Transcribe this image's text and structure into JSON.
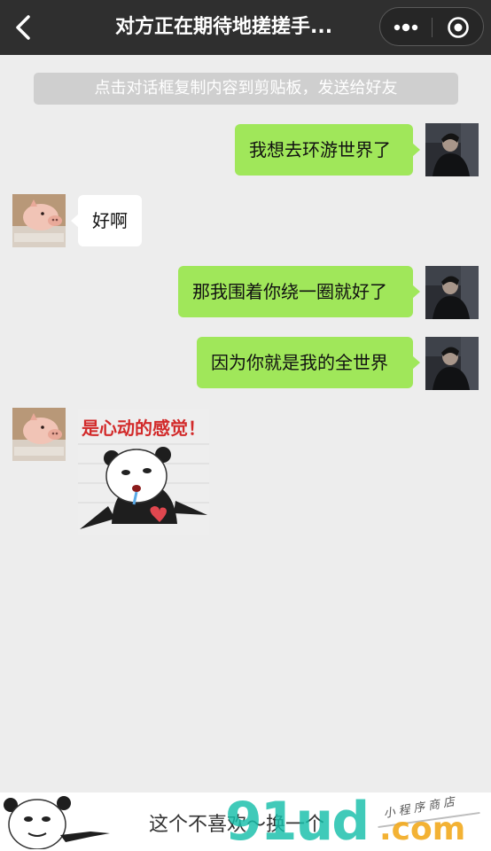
{
  "navbar": {
    "title": "对方正在期待地搓搓手...",
    "back_icon": "chevron-left-icon",
    "more_icon": "more-dots-icon",
    "close_icon": "target-circle-icon"
  },
  "hint": "点击对话框复制内容到剪贴板，发送给好友",
  "messages": [
    {
      "side": "right",
      "type": "text",
      "text": "我想去环游世界了"
    },
    {
      "side": "left",
      "type": "text",
      "text": "好啊"
    },
    {
      "side": "right",
      "type": "text",
      "text": "那我围着你绕一圈就好了"
    },
    {
      "side": "right",
      "type": "text",
      "text": "因为你就是我的全世界"
    },
    {
      "side": "left",
      "type": "sticker",
      "caption": "是心动的感觉！"
    }
  ],
  "bottom": {
    "swap_text": "这个不喜欢～换一个",
    "watermark_main": "91ud",
    "watermark_domain": ".com",
    "watermark_small": "小程序商店"
  },
  "colors": {
    "navbar": "#2f2f2f",
    "background": "#ededed",
    "green_bubble": "#a0e75a",
    "white_bubble": "#ffffff",
    "sticker_caption": "#d22a2a"
  }
}
